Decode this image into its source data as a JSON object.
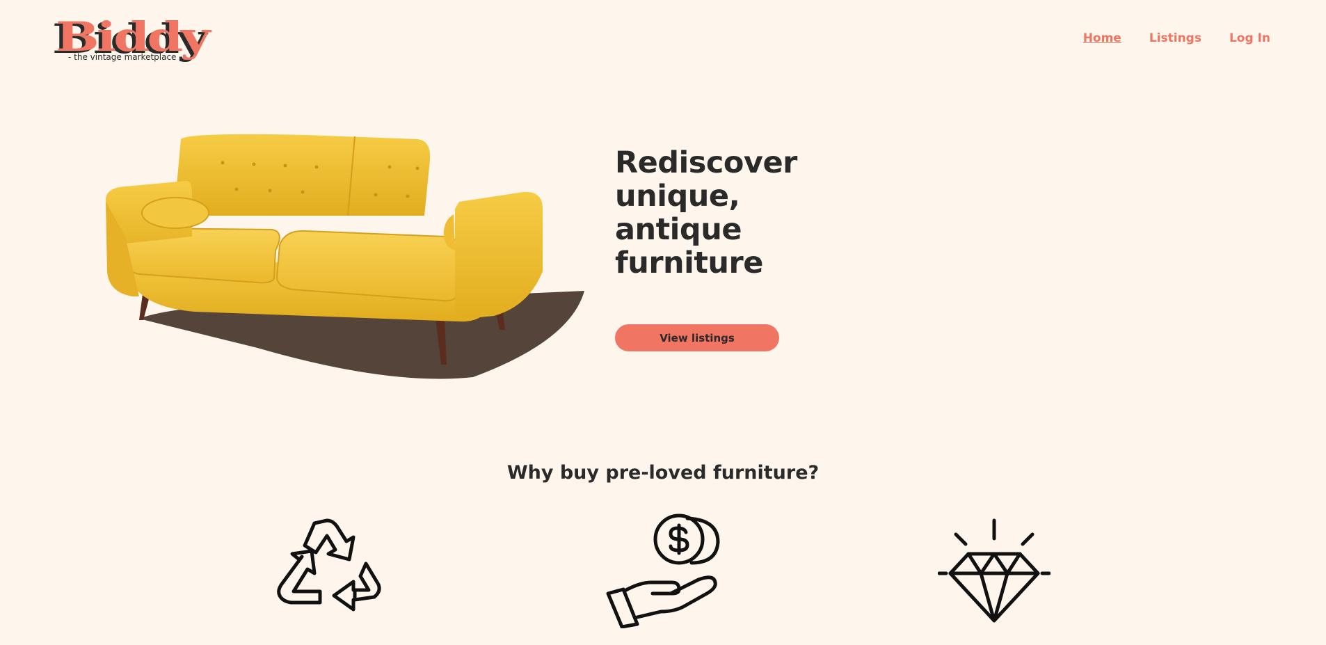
{
  "brand": {
    "name": "Biddy",
    "tagline": "- the vintage marketplace -"
  },
  "nav": {
    "items": [
      {
        "label": "Home",
        "active": true
      },
      {
        "label": "Listings",
        "active": false
      },
      {
        "label": "Log In",
        "active": false
      }
    ]
  },
  "hero": {
    "title": "Rediscover unique, antique furniture",
    "cta_label": "View listings",
    "image_icon": "yellow-sofa-image"
  },
  "why": {
    "title": "Why buy pre-loved furniture?",
    "icons": [
      "recycle-icon",
      "money-hand-icon",
      "diamond-icon"
    ]
  },
  "colors": {
    "background": "#fef6ec",
    "accent": "#f07562",
    "text": "#2a2a2a",
    "sofa": "#f2c43a"
  }
}
